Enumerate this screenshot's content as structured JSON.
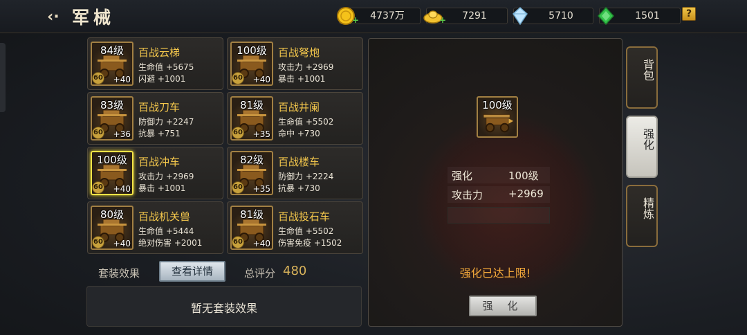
{
  "header": {
    "back_icon": "back-arrow-icon",
    "title": "军械",
    "help_label": "?"
  },
  "resources": [
    {
      "name": "gold-coin",
      "value": "4737万",
      "icon": "gold-coin-icon",
      "color": "#f5c21a",
      "has_plus": true
    },
    {
      "name": "gold-ingot",
      "value": "7291",
      "icon": "gold-ingot-icon",
      "color": "#f2c230",
      "has_plus": true
    },
    {
      "name": "crystal",
      "value": "5710",
      "icon": "crystal-icon",
      "color": "#bfe6ff",
      "has_plus": false
    },
    {
      "name": "jade",
      "value": "1501",
      "icon": "jade-icon",
      "color": "#33c24a",
      "has_plus": false
    }
  ],
  "equipment": [
    {
      "level": "84级",
      "name": "百战云梯",
      "tier": "60",
      "plus": "+40",
      "stats": [
        "生命值 +5675",
        "闪避 +1001"
      ],
      "selected": false
    },
    {
      "level": "100级",
      "name": "百战弩炮",
      "tier": "60",
      "plus": "+40",
      "stats": [
        "攻击力 +2969",
        "暴击 +1001"
      ],
      "selected": false
    },
    {
      "level": "83级",
      "name": "百战刀车",
      "tier": "60",
      "plus": "+36",
      "stats": [
        "防御力 +2247",
        "抗暴 +751"
      ],
      "selected": false
    },
    {
      "level": "81级",
      "name": "百战井阑",
      "tier": "60",
      "plus": "+35",
      "stats": [
        "生命值 +5502",
        "命中 +730"
      ],
      "selected": false
    },
    {
      "level": "100级",
      "name": "百战冲车",
      "tier": "60",
      "plus": "+40",
      "stats": [
        "攻击力 +2969",
        "暴击 +1001"
      ],
      "selected": true
    },
    {
      "level": "82级",
      "name": "百战楼车",
      "tier": "60",
      "plus": "+35",
      "stats": [
        "防御力 +2224",
        "抗暴 +730"
      ],
      "selected": false
    },
    {
      "level": "80级",
      "name": "百战机关兽",
      "tier": "60",
      "plus": "+40",
      "stats": [
        "生命值 +5444",
        "绝对伤害 +2001"
      ],
      "selected": false
    },
    {
      "level": "81级",
      "name": "百战投石车",
      "tier": "60",
      "plus": "+40",
      "stats": [
        "生命值 +5502",
        "伤害免疫 +1502"
      ],
      "selected": false
    }
  ],
  "set_effect": {
    "label": "套装效果",
    "detail_button": "查看详情",
    "score_label": "总评分",
    "score_value": "480",
    "none_text": "暂无套装效果"
  },
  "detail": {
    "level": "100级",
    "rows": [
      {
        "key": "强化",
        "value": "100级"
      },
      {
        "key": "攻击力",
        "value": "+2969"
      }
    ],
    "max_text": "强化已达上限!",
    "enhance_button": "强 化"
  },
  "side_tabs": [
    {
      "label": "背包",
      "active": false
    },
    {
      "label": "强化",
      "active": true
    },
    {
      "label": "精炼",
      "active": false
    }
  ]
}
